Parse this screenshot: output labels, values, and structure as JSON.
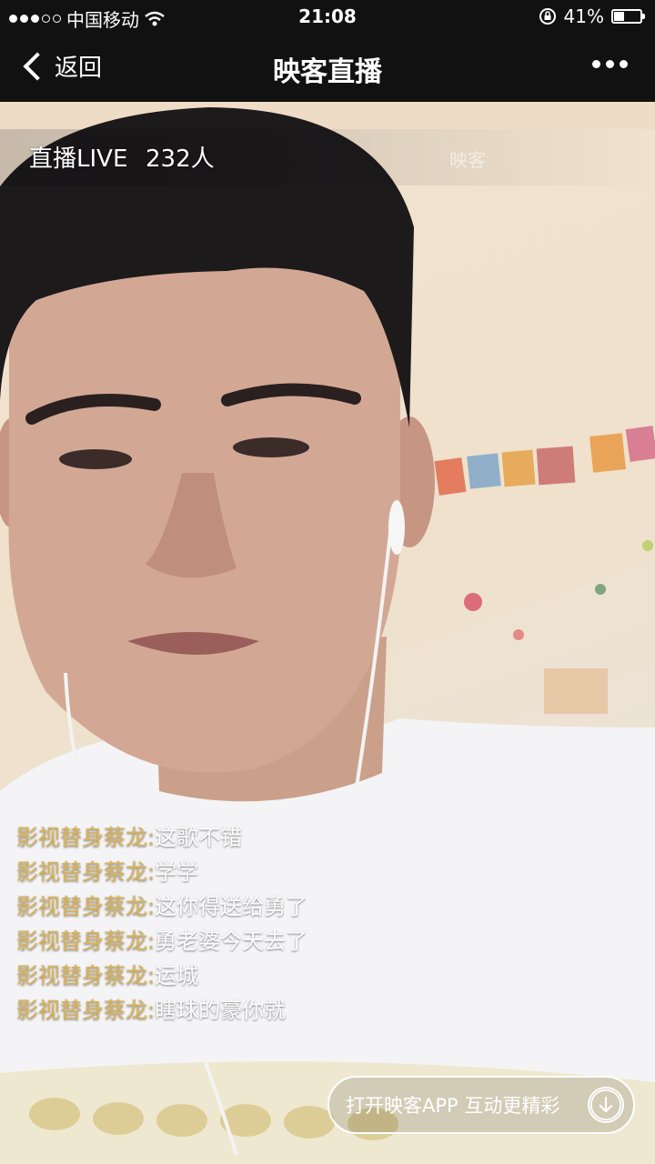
{
  "status_bar": {
    "carrier": "中国移动",
    "time": "21:08",
    "battery": "41%",
    "battery_level": 0.41,
    "icons": [
      "signal-dots-icon",
      "wifi-icon",
      "rotation-lock-icon",
      "battery-icon"
    ]
  },
  "nav": {
    "back_label": "返回",
    "title": "映客直播",
    "more_icon": "more-dots-icon"
  },
  "live": {
    "label": "直播LIVE",
    "viewers": "232人",
    "faint_text": "映客"
  },
  "chat": [
    {
      "user": "影视替身蔡龙:",
      "message": "这歌不错"
    },
    {
      "user": "影视替身蔡龙:",
      "message": "学学"
    },
    {
      "user": "影视替身蔡龙:",
      "message": "这你得送给勇了"
    },
    {
      "user": "影视替身蔡龙:",
      "message": "勇老婆今天去了"
    },
    {
      "user": "影视替身蔡龙:",
      "message": "运城"
    },
    {
      "user": "影视替身蔡龙:",
      "message": "瞎球的豪你就"
    }
  ],
  "open_app": {
    "label": "打开映客APP  互动更精彩",
    "icon": "download-arrow-icon"
  },
  "colors": {
    "bar_bg": "#111111",
    "chat_user": "#d9b257",
    "chat_message": "#ffffff"
  }
}
